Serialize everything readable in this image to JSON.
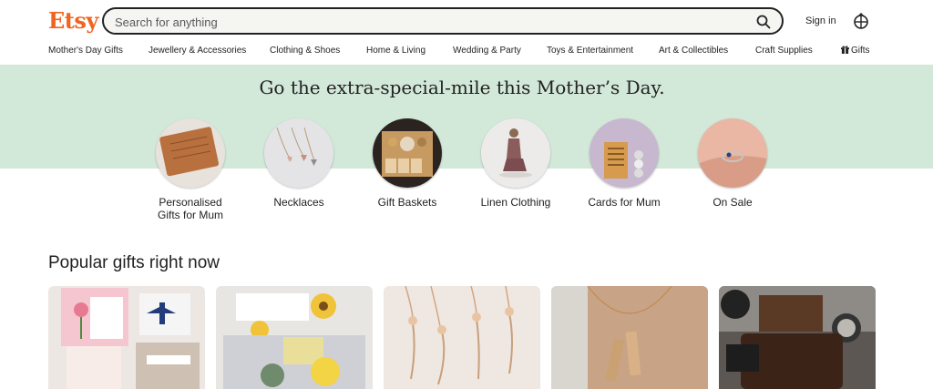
{
  "header": {
    "logo": "Etsy",
    "search_placeholder": "Search for anything",
    "signin_label": "Sign in"
  },
  "nav": {
    "items": [
      "Mother's Day Gifts",
      "Jewellery & Accessories",
      "Clothing & Shoes",
      "Home & Living",
      "Wedding & Party",
      "Toys & Entertainment",
      "Art & Collectibles",
      "Craft Supplies",
      "Gifts"
    ]
  },
  "hero": {
    "title": "Go the extra-special-mile this Mother’s Day.",
    "categories": [
      {
        "line1": "Personalised",
        "line2": "Gifts for Mum"
      },
      {
        "line1": "Necklaces",
        "line2": ""
      },
      {
        "line1": "Gift Baskets",
        "line2": ""
      },
      {
        "line1": "Linen Clothing",
        "line2": ""
      },
      {
        "line1": "Cards for Mum",
        "line2": ""
      },
      {
        "line1": "On Sale",
        "line2": ""
      }
    ]
  },
  "popular": {
    "title": "Popular gifts right now"
  },
  "colors": {
    "brand": "#f1641e",
    "hero_bg": "#d2e8d9"
  }
}
